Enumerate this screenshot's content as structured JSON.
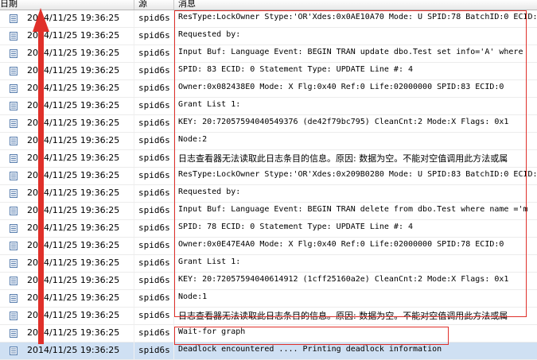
{
  "header": {
    "date_label": "日期",
    "source_label": "源",
    "message_label": "消息"
  },
  "colors": {
    "selected_row": "#cfe0f3",
    "annotation_red": "#e0302a"
  },
  "rows": [
    {
      "date": "2014/11/25 19:36:25",
      "source": "spid6s",
      "message": "ResType:LockOwner Stype:'OR'Xdes:0x0AE10A70 Mode: U SPID:78 BatchID:0 ECID:",
      "cjk": false
    },
    {
      "date": "2014/11/25 19:36:25",
      "source": "spid6s",
      "message": "Requested by:",
      "cjk": false
    },
    {
      "date": "2014/11/25 19:36:25",
      "source": "spid6s",
      "message": "Input Buf: Language Event: BEGIN TRAN   update dbo.Test set info='A' where",
      "cjk": false
    },
    {
      "date": "2014/11/25 19:36:25",
      "source": "spid6s",
      "message": "SPID: 83 ECID: 0 Statement Type: UPDATE Line #: 4",
      "cjk": false
    },
    {
      "date": "2014/11/25 19:36:25",
      "source": "spid6s",
      "message": "Owner:0x082438E0 Mode: X        Flg:0x40 Ref:0 Life:02000000 SPID:83 ECID:0",
      "cjk": false
    },
    {
      "date": "2014/11/25 19:36:25",
      "source": "spid6s",
      "message": "Grant List 1:",
      "cjk": false
    },
    {
      "date": "2014/11/25 19:36:25",
      "source": "spid6s",
      "message": "KEY: 20:72057594040549376 (de42f79bc795) CleanCnt:2 Mode:X Flags: 0x1",
      "cjk": false
    },
    {
      "date": "2014/11/25 19:36:25",
      "source": "spid6s",
      "message": "Node:2",
      "cjk": false
    },
    {
      "date": "2014/11/25 19:36:25",
      "source": "spid6s",
      "message": "日志查看器无法读取此日志条目的信息。原因: 数据为空。不能对空值调用此方法或属",
      "cjk": true
    },
    {
      "date": "2014/11/25 19:36:25",
      "source": "spid6s",
      "message": "ResType:LockOwner Stype:'OR'Xdes:0x209B0280 Mode: U SPID:83 BatchID:0 ECID:",
      "cjk": false
    },
    {
      "date": "2014/11/25 19:36:25",
      "source": "spid6s",
      "message": "Requested by:",
      "cjk": false
    },
    {
      "date": "2014/11/25 19:36:25",
      "source": "spid6s",
      "message": "Input Buf: Language Event: BEGIN TRAN   delete from dbo.Test where name ='m",
      "cjk": false
    },
    {
      "date": "2014/11/25 19:36:25",
      "source": "spid6s",
      "message": "SPID: 78 ECID: 0 Statement Type: UPDATE Line #: 4",
      "cjk": false
    },
    {
      "date": "2014/11/25 19:36:25",
      "source": "spid6s",
      "message": "Owner:0x0E47E4A0 Mode: X        Flg:0x40 Ref:0 Life:02000000 SPID:78 ECID:0",
      "cjk": false
    },
    {
      "date": "2014/11/25 19:36:25",
      "source": "spid6s",
      "message": "Grant List 1:",
      "cjk": false
    },
    {
      "date": "2014/11/25 19:36:25",
      "source": "spid6s",
      "message": "KEY: 20:72057594040614912 (1cff25160a2e) CleanCnt:2 Mode:X Flags: 0x1",
      "cjk": false
    },
    {
      "date": "2014/11/25 19:36:25",
      "source": "spid6s",
      "message": "Node:1",
      "cjk": false
    },
    {
      "date": "2014/11/25 19:36:25",
      "source": "spid6s",
      "message": "日志查看器无法读取此日志条目的信息。原因: 数据为空。不能对空值调用此方法或属",
      "cjk": true
    },
    {
      "date": "2014/11/25 19:36:25",
      "source": "spid6s",
      "message": "Wait-for graph",
      "cjk": false
    },
    {
      "date": "2014/11/25 19:36:25",
      "source": "spid6s",
      "message": "Deadlock encountered .... Printing deadlock information",
      "cjk": false,
      "selected": true
    }
  ]
}
